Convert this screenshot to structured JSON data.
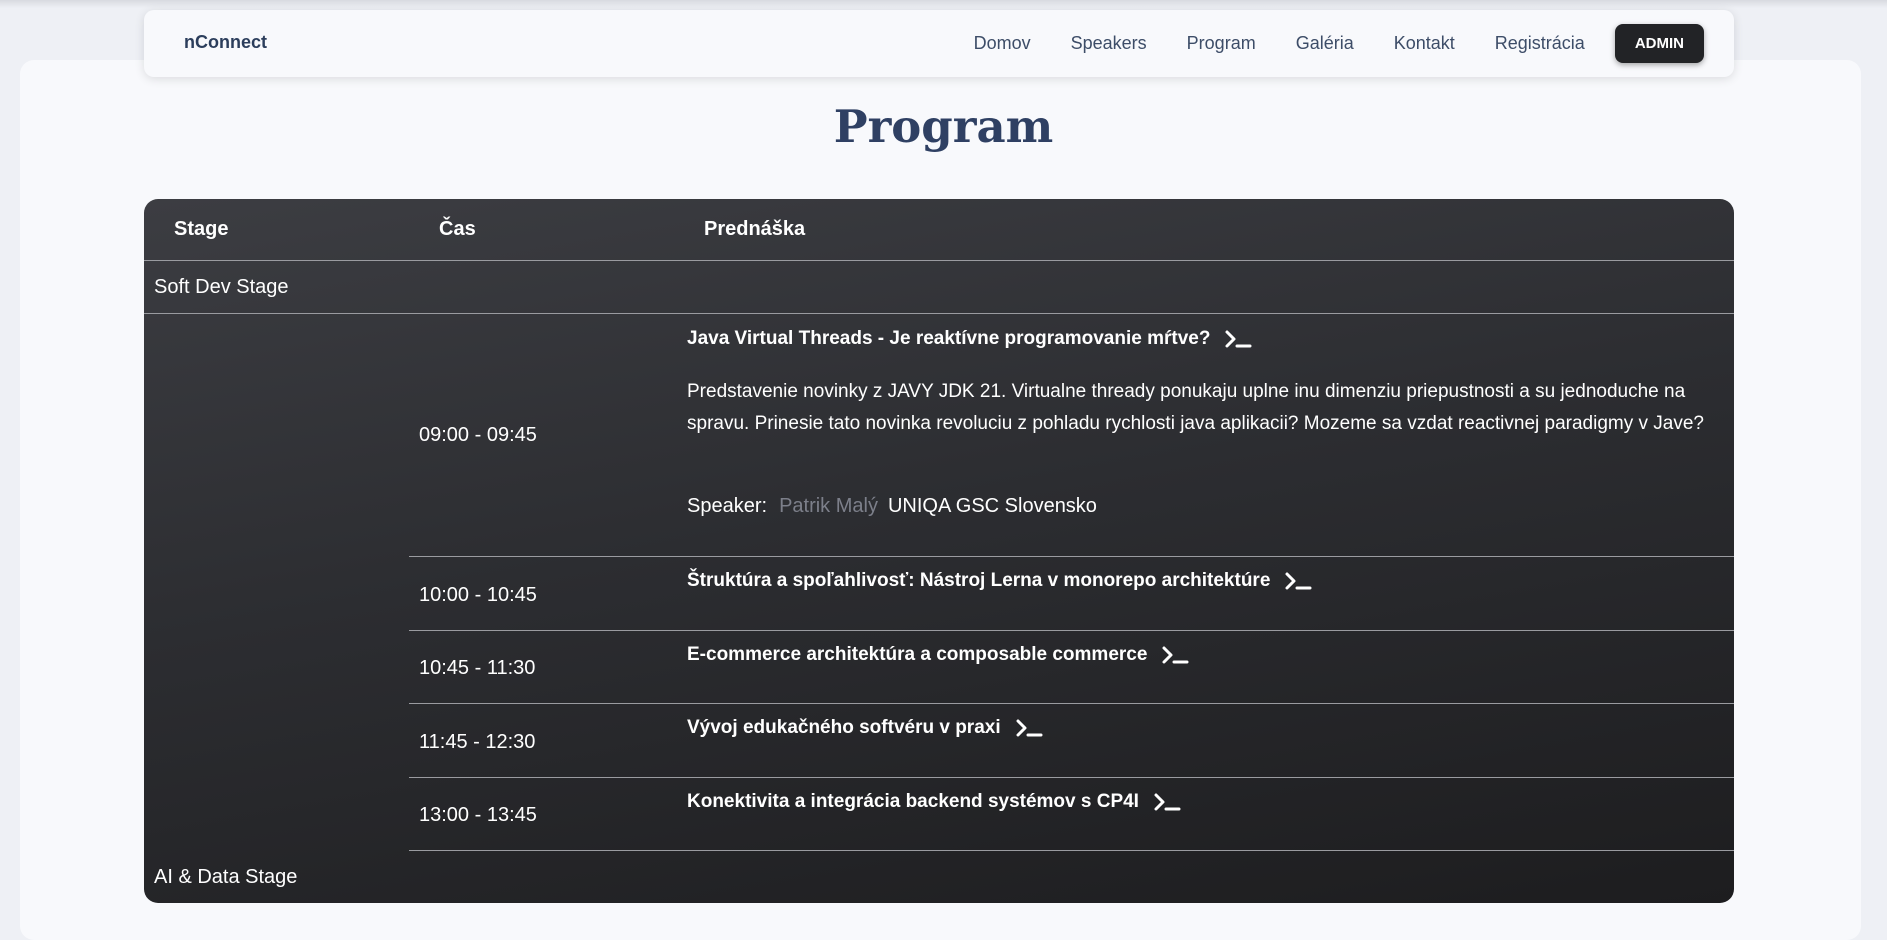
{
  "nav": {
    "brand": "nConnect",
    "links": [
      "Domov",
      "Speakers",
      "Program",
      "Galéria",
      "Kontakt",
      "Registrácia"
    ],
    "admin_label": "ADMIN"
  },
  "page": {
    "title": "Program"
  },
  "table": {
    "headers": {
      "stage": "Stage",
      "time": "Čas",
      "talk": "Prednáška"
    },
    "stages": [
      {
        "name": "Soft Dev Stage",
        "slots": [
          {
            "time": "09:00 - 09:45",
            "title": "Java Virtual Threads - Je reaktívne programovanie mŕtve?",
            "description": "Predstavenie novinky z JAVY JDK 21. Virtualne thready ponukaju uplne inu dimenziu priepustnosti a su jednoduche na spravu. Prinesie tato novinka revoluciu z pohladu rychlosti java aplikacii? Mozeme sa vzdat reactivnej paradigmy v Jave?",
            "speaker_label": "Speaker:",
            "speaker_name": "Patrik Malý",
            "speaker_company": "UNIQA GSC Slovensko"
          },
          {
            "time": "10:00 - 10:45",
            "title": "Štruktúra a spoľahlivosť: Nástroj Lerna v monorepo architektúre"
          },
          {
            "time": "10:45 - 11:30",
            "title": "E-commerce architektúra a composable commerce"
          },
          {
            "time": "11:45 - 12:30",
            "title": "Vývoj edukačného softvéru v praxi"
          },
          {
            "time": "13:00 - 13:45",
            "title": "Konektivita a integrácia backend systémov s CP4I"
          }
        ]
      },
      {
        "name": "AI & Data Stage"
      }
    ]
  },
  "icons": {
    "talk_expand": "terminal-prompt-icon"
  },
  "colors": {
    "title": "#2f4063",
    "admin_bg": "#222326",
    "table_bg": "#2c2d31",
    "speaker_link": "#7c7f8a"
  }
}
